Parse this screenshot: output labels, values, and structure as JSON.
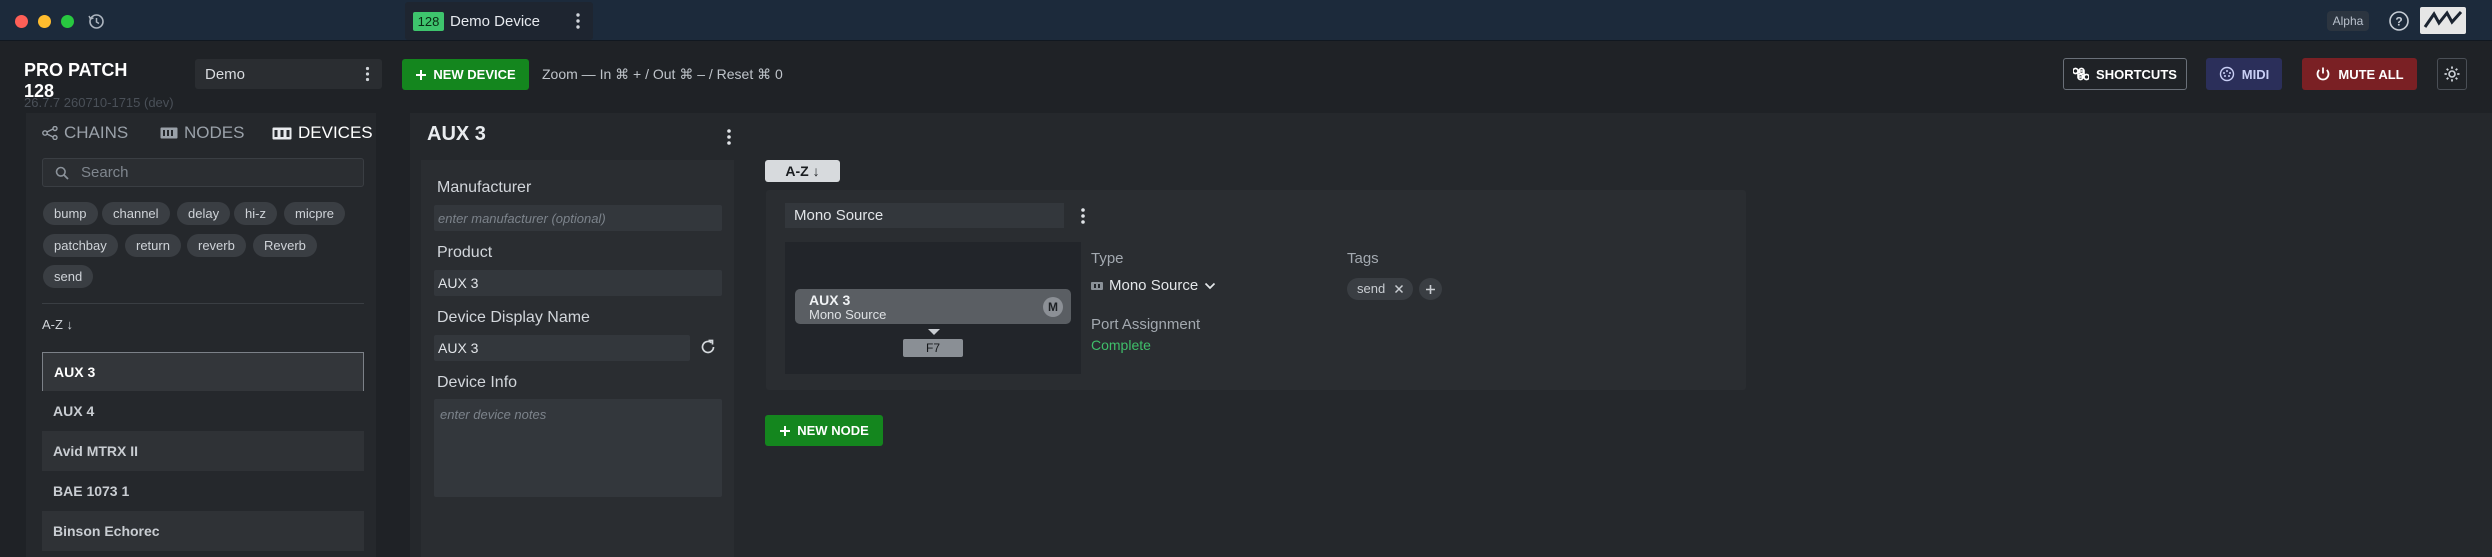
{
  "titlebar": {
    "tab": {
      "badge": "128",
      "label": "Demo Device"
    },
    "alpha_label": "Alpha"
  },
  "header": {
    "brand": "PRO PATCH 128",
    "version": "26.7.7 260710-1715 (dev)",
    "project_select": "Demo",
    "new_device_label": "NEW DEVICE",
    "zoom_hint": "Zoom — In ⌘ + / Out ⌘ – / Reset ⌘ 0",
    "shortcuts_label": "SHORTCUTS",
    "midi_label": "MIDI",
    "mute_all_label": "MUTE ALL"
  },
  "sidebar": {
    "tabs": [
      {
        "label": "CHAINS"
      },
      {
        "label": "NODES"
      },
      {
        "label": "DEVICES"
      }
    ],
    "search_placeholder": "Search",
    "tags": [
      "bump",
      "channel",
      "delay",
      "hi-z",
      "micpre",
      "patchbay",
      "return",
      "reverb",
      "Reverb",
      "send"
    ],
    "sort_label": "A-Z ↓",
    "devices": [
      "AUX 3",
      "AUX 4",
      "Avid MTRX II",
      "BAE 1073 1",
      "Binson Echorec"
    ]
  },
  "device": {
    "title": "AUX 3",
    "manufacturer_label": "Manufacturer",
    "manufacturer_placeholder": "enter manufacturer (optional)",
    "product_label": "Product",
    "product_value": "AUX 3",
    "display_name_label": "Device Display Name",
    "display_name_value": "AUX 3",
    "info_label": "Device Info",
    "info_placeholder": "enter device notes"
  },
  "nodes": {
    "sort_label": "A-Z ↓",
    "node": {
      "name": "Mono Source",
      "preview_title": "AUX 3",
      "preview_subtitle": "Mono Source",
      "preview_badge": "M",
      "port_label": "F7",
      "type_label": "Type",
      "type_value": "Mono Source",
      "tags_label": "Tags",
      "tags": [
        "send"
      ],
      "port_assignment_label": "Port Assignment",
      "port_assignment_value": "Complete"
    },
    "new_node_label": "NEW NODE"
  },
  "colors": {
    "accent_green": "#14861e",
    "complete_green": "#3fbf6a",
    "badge_green": "#3ec46d",
    "mute_red": "#7a2024",
    "midi_blue": "#2b2f5a"
  }
}
